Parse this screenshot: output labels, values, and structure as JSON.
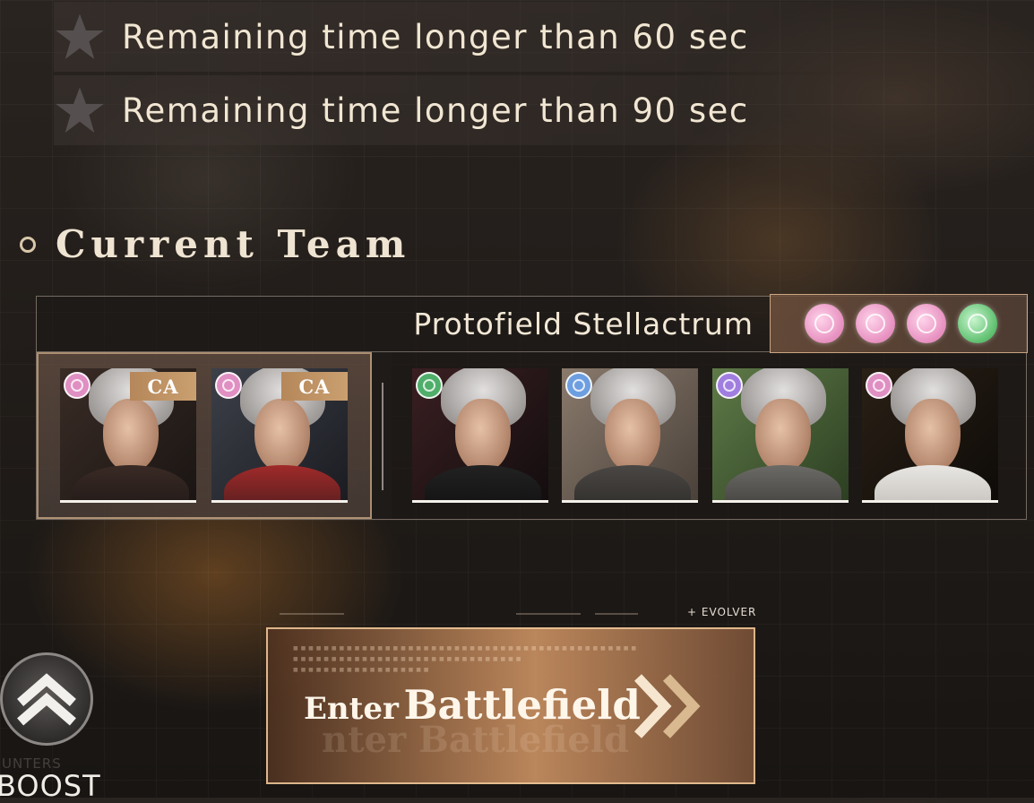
{
  "conditions": [
    {
      "text": "Remaining time longer than 60 sec",
      "icon": "star-icon",
      "achieved": false
    },
    {
      "text": "Remaining time longer than 90 sec",
      "icon": "star-icon",
      "achieved": false
    }
  ],
  "section": {
    "title": "Current Team"
  },
  "team": {
    "formation_name": "Protofield Stellactrum",
    "formation_elements": [
      {
        "icon": "pink-orb-icon",
        "color": "#e68fbf"
      },
      {
        "icon": "pink-orb-icon",
        "color": "#e68fbf"
      },
      {
        "icon": "pink-orb-icon",
        "color": "#e68fbf"
      },
      {
        "icon": "green-orb-icon",
        "color": "#5dbf6d"
      }
    ],
    "support_cards": [
      {
        "tag": "CA",
        "orb_color": "#e08fc2",
        "icon": "pink-orb-icon"
      },
      {
        "tag": "CA",
        "orb_color": "#e08fc2",
        "icon": "pink-orb-icon"
      }
    ],
    "main_cards": [
      {
        "orb_color": "#4fae6a",
        "icon": "green-orb-icon"
      },
      {
        "orb_color": "#6d9ee0",
        "icon": "blue-orb-icon"
      },
      {
        "orb_color": "#a07ee0",
        "icon": "purple-orb-icon"
      },
      {
        "orb_color": "#e08fc2",
        "icon": "pink-orb-icon"
      }
    ]
  },
  "boost": {
    "label": "BOOST",
    "sub_label": "UNTERS"
  },
  "enter": {
    "label_small": "Enter",
    "label_big": "Battlefield",
    "ghost": "nter Battlefield",
    "tag": "+ EVOLVER"
  },
  "colors": {
    "accent": "#caa070",
    "text": "#f1e6d2"
  }
}
